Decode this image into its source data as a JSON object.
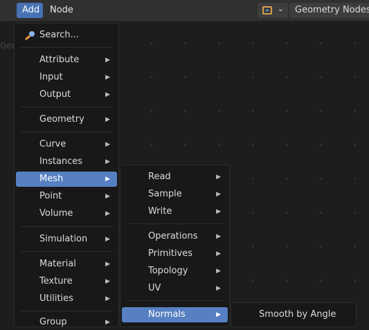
{
  "header": {
    "add_label": "Add",
    "node_label": "Node",
    "editor_type_icon": "node-editor-icon",
    "tree_name": "Geometry Nodes"
  },
  "canvas": {
    "ghost_label": "GeometryNodes"
  },
  "add_menu": {
    "search_label": "Search...",
    "items": [
      {
        "label": "Attribute",
        "submenu": true
      },
      {
        "label": "Input",
        "submenu": true
      },
      {
        "label": "Output",
        "submenu": true
      },
      {
        "label": "Geometry",
        "submenu": true
      },
      {
        "label": "Curve",
        "submenu": true
      },
      {
        "label": "Instances",
        "submenu": true
      },
      {
        "label": "Mesh",
        "submenu": true,
        "active": true
      },
      {
        "label": "Point",
        "submenu": true
      },
      {
        "label": "Volume",
        "submenu": true
      },
      {
        "label": "Simulation",
        "submenu": true
      },
      {
        "label": "Material",
        "submenu": true
      },
      {
        "label": "Texture",
        "submenu": true
      },
      {
        "label": "Utilities",
        "submenu": true
      },
      {
        "label": "Group",
        "submenu": true
      }
    ]
  },
  "mesh_menu": {
    "items": [
      {
        "label": "Read",
        "submenu": true
      },
      {
        "label": "Sample",
        "submenu": true
      },
      {
        "label": "Write",
        "submenu": true
      },
      {
        "label": "Operations",
        "submenu": true
      },
      {
        "label": "Primitives",
        "submenu": true
      },
      {
        "label": "Topology",
        "submenu": true
      },
      {
        "label": "UV",
        "submenu": true
      },
      {
        "label": "Normals",
        "submenu": true,
        "active": true
      }
    ]
  },
  "normals_menu": {
    "items": [
      {
        "label": "Smooth by Angle"
      }
    ]
  },
  "colors": {
    "accent": "#4772b3",
    "highlight": "#5680c2",
    "menu_bg": "#181818",
    "canvas_bg": "#1d1d1d"
  }
}
